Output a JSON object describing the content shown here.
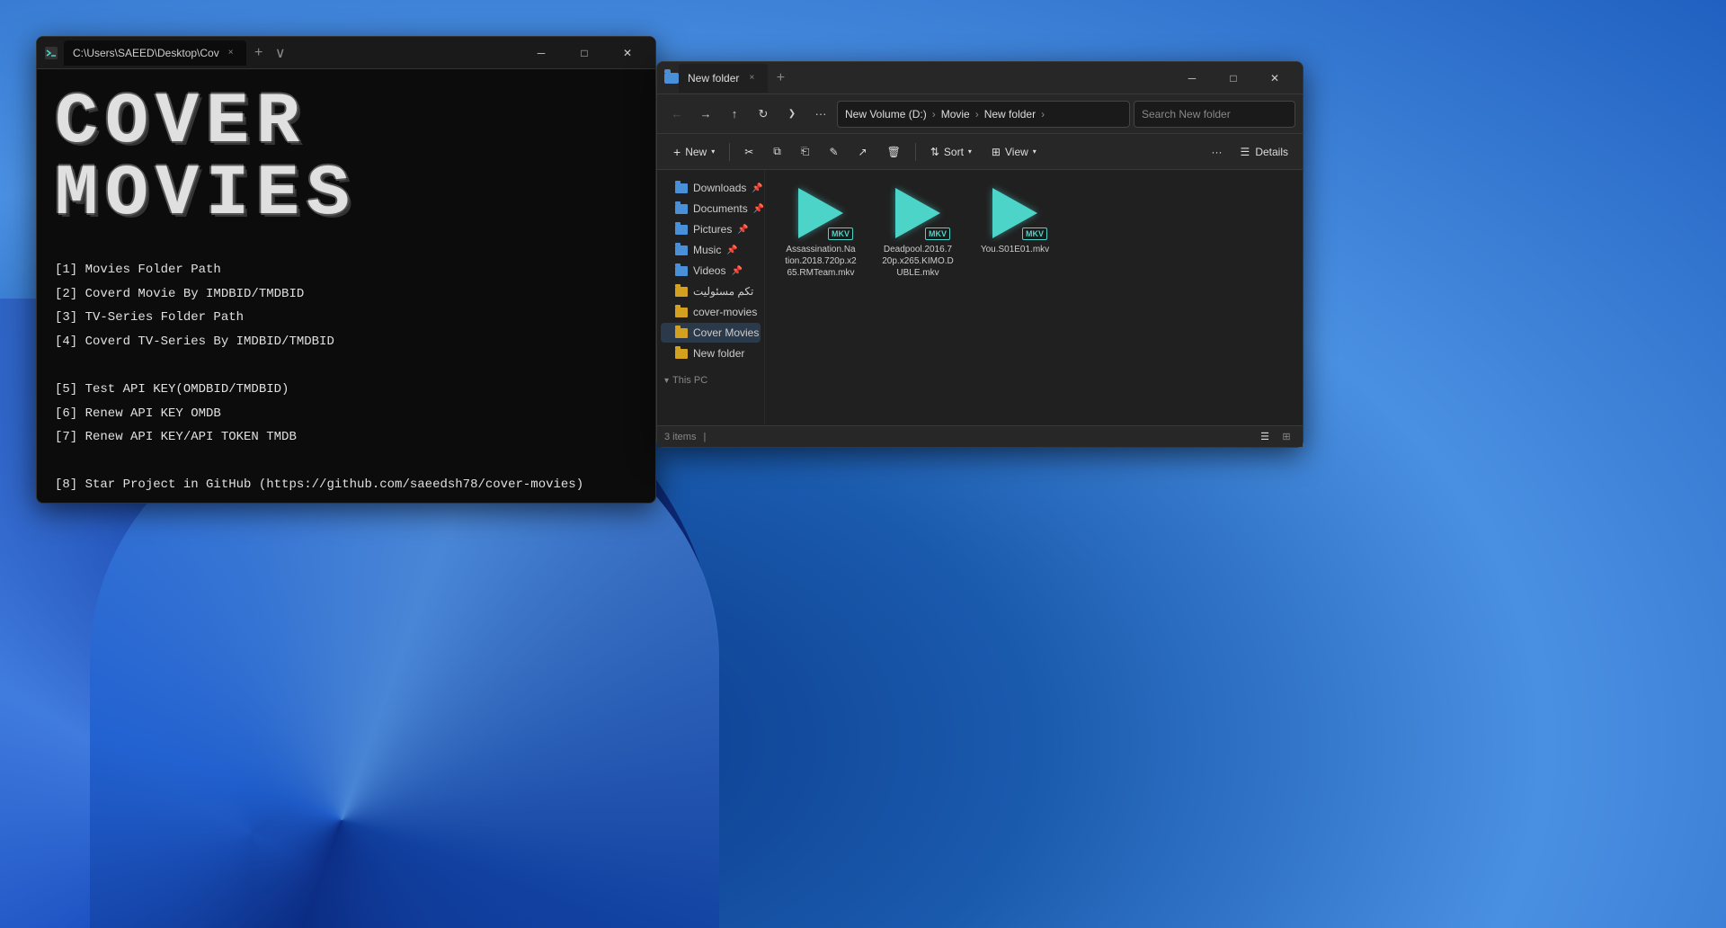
{
  "desktop": {
    "bg_color": "#1a5aad"
  },
  "terminal": {
    "title": "C:\\Users\\SAEED\\Desktop\\Cov",
    "title_short": "C:\\Users\\SAEED\\Desktop\\Cov",
    "tab_label": "C:\\Users\\SAEED\\Desktop\\Cov",
    "logo_line1": "COVER",
    "logo_line2": "MOVIES",
    "menu_items": [
      "[1]  Movies Folder Path",
      "[2]  Coverd Movie By IMDBID/TMDBID",
      "[3]  TV-Series Folder Path",
      "[4]  Coverd TV-Series By IMDBID/TMDBID",
      "",
      "[5]  Test API KEY(OMDBID/TMDBID)",
      "[6]  Renew API KEY OMDB",
      "[7]  Renew API KEY/API TOKEN TMDB",
      "",
      "[8]  Star Project in GitHub (https://github.com/saeedsh78/cover-movies)"
    ],
    "controls": {
      "minimize": "─",
      "maximize": "□",
      "close": "✕"
    }
  },
  "explorer": {
    "title": "New folder",
    "tab_label": "New folder",
    "breadcrumb": {
      "root": "New Volume (D:)",
      "sep1": ">",
      "part1": "Movie",
      "sep2": ">",
      "part2": "New folder",
      "sep3": ">"
    },
    "search_placeholder": "Search New folder",
    "toolbar_buttons": [
      {
        "label": "New",
        "icon": "+"
      },
      {
        "label": "Cut",
        "icon": "✂"
      },
      {
        "label": "Copy",
        "icon": "⧉"
      },
      {
        "label": "Paste",
        "icon": "📋"
      },
      {
        "label": "Rename",
        "icon": "✎"
      },
      {
        "label": "Share",
        "icon": "↗"
      },
      {
        "label": "Delete",
        "icon": "🗑"
      }
    ],
    "sort_label": "Sort",
    "view_label": "View",
    "details_label": "Details",
    "sidebar": {
      "downloads_label": "Downloads",
      "documents_label": "Documents",
      "pictures_label": "Pictures",
      "music_label": "Music",
      "videos_label": "Videos",
      "masooliat_label": "تکم مسئولیت",
      "cover_movies_lower_label": "cover-movies",
      "cover_movies_label": "Cover Movies",
      "new_folder_label": "New folder",
      "this_pc_label": "This PC"
    },
    "files": [
      {
        "name": "Assassination.Nation.2018.720p.x265.RMTeam.mkv",
        "display_name": "Assassination.Na\ntion.2018.720p.x2\n65.RMTeam.mkv",
        "type": "MKV"
      },
      {
        "name": "Deadpool.2016.720p.x265.KIMO.DUBLE.mkv",
        "display_name": "Deadpool.2016.7\n20p.x265.KIMO.D\nUBLE.mkv",
        "type": "MKV"
      },
      {
        "name": "You.S01E01.mkv",
        "display_name": "You.S01E01.mkv",
        "type": "MKV"
      }
    ],
    "status": {
      "items_count": "3 items",
      "separator": "|"
    },
    "controls": {
      "minimize": "─",
      "maximize": "□",
      "close": "✕"
    }
  }
}
